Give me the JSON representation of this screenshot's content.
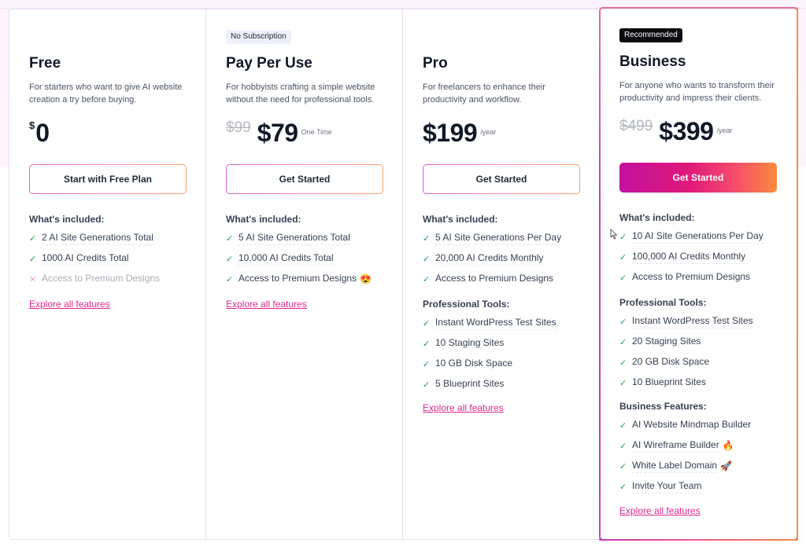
{
  "plans": [
    {
      "name": "Free",
      "badge": null,
      "description": "For starters who want to give AI website creation a try before buying.",
      "price": {
        "currency": "$",
        "amount": "0",
        "old": null,
        "unit": null
      },
      "cta": "Start with Free Plan",
      "sections": [
        {
          "title": "What's included:",
          "items": [
            {
              "icon": "check-icon",
              "text": "2 AI Site Generations Total",
              "included": true
            },
            {
              "icon": "check-icon",
              "text": "1000 AI Credits Total",
              "included": true
            },
            {
              "icon": "cross-icon",
              "text": "Access to Premium Designs",
              "included": false
            }
          ]
        }
      ],
      "explore": "Explore all features"
    },
    {
      "name": "Pay Per Use",
      "badge": "No Subscription",
      "description": "For hobbyists crafting a simple website without the need for professional tools.",
      "price": {
        "currency": "$",
        "amount": "$79",
        "old": "$99",
        "unit": "One Time"
      },
      "cta": "Get Started",
      "sections": [
        {
          "title": "What's included:",
          "items": [
            {
              "icon": "check-icon",
              "text": "5 AI Site Generations Total",
              "included": true
            },
            {
              "icon": "check-icon",
              "text": "10,000 AI Credits Total",
              "included": true
            },
            {
              "icon": "check-icon",
              "text": "Access to Premium Designs",
              "included": true,
              "emoji": "😍"
            }
          ]
        }
      ],
      "explore": "Explore all features"
    },
    {
      "name": "Pro",
      "badge": null,
      "description": "For freelancers to enhance their productivity and workflow.",
      "price": {
        "currency": "$",
        "amount": "$199",
        "old": null,
        "unit": "/year"
      },
      "cta": "Get Started",
      "sections": [
        {
          "title": "What's included:",
          "items": [
            {
              "icon": "check-icon",
              "text": "5 AI Site Generations Per Day",
              "included": true
            },
            {
              "icon": "check-icon",
              "text": "20,000 AI Credits Monthly",
              "included": true
            },
            {
              "icon": "check-icon",
              "text": "Access to Premium Designs",
              "included": true
            }
          ]
        },
        {
          "title": "Professional Tools:",
          "items": [
            {
              "icon": "check-icon",
              "text": "Instant WordPress Test Sites",
              "included": true
            },
            {
              "icon": "check-icon",
              "text": "10 Staging Sites",
              "included": true
            },
            {
              "icon": "check-icon",
              "text": "10 GB Disk Space",
              "included": true
            },
            {
              "icon": "check-icon",
              "text": "5 Blueprint Sites",
              "included": true
            }
          ]
        }
      ],
      "explore": "Explore all features"
    },
    {
      "name": "Business",
      "badge": "Recommended",
      "description": "For anyone who wants to transform their productivity and impress their clients.",
      "price": {
        "currency": "$",
        "amount": "$399",
        "old": "$499",
        "unit": "/year"
      },
      "cta": "Get Started",
      "sections": [
        {
          "title": "What's included:",
          "items": [
            {
              "icon": "check-icon",
              "text": "10 AI Site Generations Per Day",
              "included": true
            },
            {
              "icon": "check-icon",
              "text": "100,000 AI Credits Monthly",
              "included": true
            },
            {
              "icon": "check-icon",
              "text": "Access to Premium Designs",
              "included": true
            }
          ]
        },
        {
          "title": "Professional Tools:",
          "items": [
            {
              "icon": "check-icon",
              "text": "Instant WordPress Test Sites",
              "included": true
            },
            {
              "icon": "check-icon",
              "text": "20 Staging Sites",
              "included": true
            },
            {
              "icon": "check-icon",
              "text": "20 GB Disk Space",
              "included": true
            },
            {
              "icon": "check-icon",
              "text": "10 Blueprint Sites",
              "included": true
            }
          ]
        },
        {
          "title": "Business Features:",
          "items": [
            {
              "icon": "check-icon",
              "text": "AI Website Mindmap Builder",
              "included": true
            },
            {
              "icon": "check-icon",
              "text": "AI Wireframe Builder",
              "included": true,
              "emoji": "🔥"
            },
            {
              "icon": "check-icon",
              "text": "White Label Domain",
              "included": true,
              "emoji": "🚀"
            },
            {
              "icon": "check-icon",
              "text": "Invite Your Team",
              "included": true
            }
          ]
        }
      ],
      "explore": "Explore all features"
    }
  ],
  "icons": {
    "check": "✓",
    "cross": "✕"
  },
  "colors": {
    "accent_pink": "#e0298f",
    "check_green": "#22a05a",
    "cta_gradient_start": "#c2119e",
    "cta_gradient_end": "#fb8a3c"
  }
}
